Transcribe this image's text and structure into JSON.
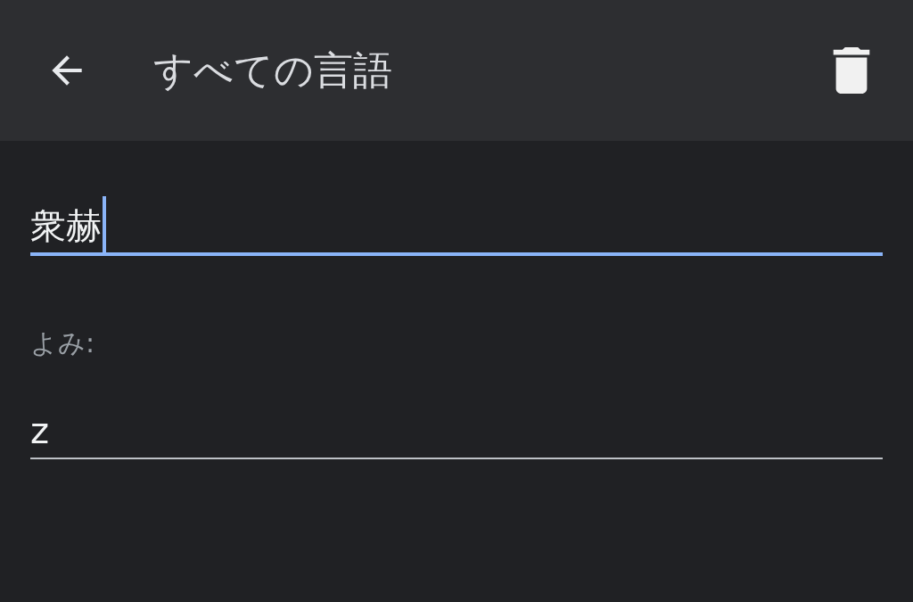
{
  "app_bar": {
    "title": "すべての言語"
  },
  "fields": [
    {
      "value": "衆赫",
      "focused": true
    },
    {
      "label": "よみ:",
      "value": "z",
      "focused": false
    }
  ]
}
